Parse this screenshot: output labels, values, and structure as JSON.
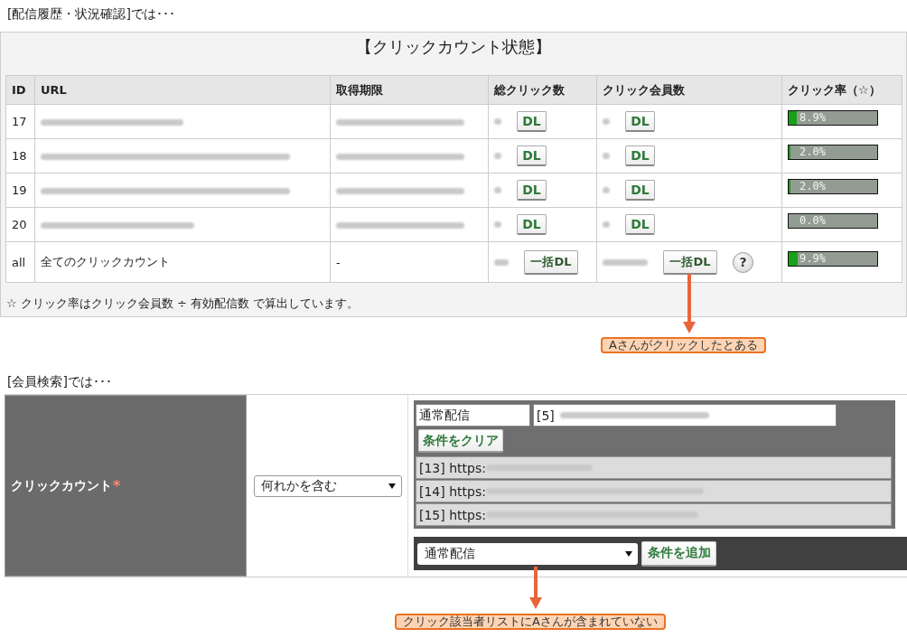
{
  "delivery_history": {
    "heading": "[配信履歴・状況確認]では･･･",
    "panel_title": "【クリックカウント状態】",
    "table": {
      "columns": [
        "ID",
        "URL",
        "取得期限",
        "総クリック数",
        "クリック会員数",
        "クリック率（☆）"
      ],
      "rows": [
        {
          "kind": "url",
          "id": "17",
          "download": "DL",
          "member_download": "DL",
          "rate": "8.9%",
          "level": 0.089
        },
        {
          "kind": "url",
          "id": "18",
          "download": "DL",
          "member_download": "DL",
          "rate": "2.0%",
          "level": 0.02
        },
        {
          "kind": "url",
          "id": "19",
          "download": "DL",
          "member_download": "DL",
          "rate": "2.0%",
          "level": 0.02
        },
        {
          "kind": "url",
          "id": "20",
          "download": "DL",
          "member_download": "DL",
          "rate": "0.0%",
          "level": 0
        },
        {
          "kind": "total",
          "id": "all",
          "url": "全てのクリックカウント",
          "expiry": "-",
          "download": "一括DL",
          "member_download": "一括DL",
          "help": "?",
          "rate": "9.9%",
          "level": 0.099
        }
      ]
    },
    "footnote": "☆ クリック率はクリック会員数 ÷ 有効配信数 で算出しています。"
  },
  "member_search": {
    "heading": "[会員検索]では･･･",
    "label": "クリックカウント",
    "required_mark": "*",
    "match_select": "何れかを含む",
    "condition": {
      "type_field": "通常配信",
      "target_prefix": "[5]",
      "clear_button": "条件をクリア",
      "items": [
        "[13] https:",
        "[14] https:",
        "[15] https:"
      ]
    },
    "add_bar": {
      "select": "通常配信",
      "button": "条件を追加"
    }
  },
  "callouts": [
    {
      "text": "Aさんがクリックしたとある"
    },
    {
      "text": "クリック該当者リストにAさんが含まれていない"
    }
  ]
}
